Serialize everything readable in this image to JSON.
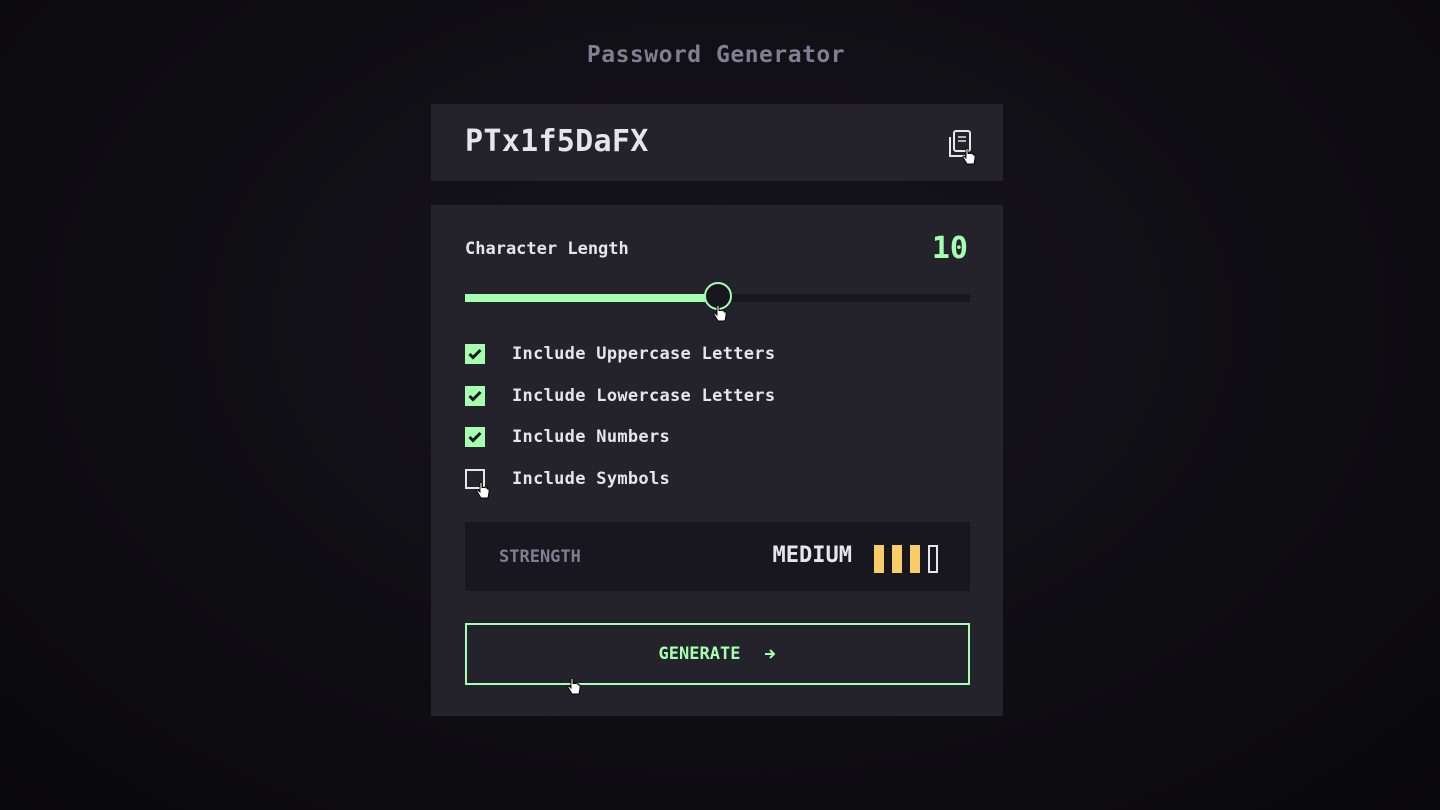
{
  "app": {
    "title": "Password Generator"
  },
  "output": {
    "password": "PTx1f5DaFX",
    "copy_icon": "copy-icon"
  },
  "length": {
    "label": "Character Length",
    "value": "10",
    "slider_fraction": 0.5
  },
  "options": [
    {
      "label": "Include Uppercase Letters",
      "checked": true
    },
    {
      "label": "Include Lowercase Letters",
      "checked": true
    },
    {
      "label": "Include Numbers",
      "checked": true
    },
    {
      "label": "Include Symbols",
      "checked": false
    }
  ],
  "strength": {
    "label": "STRENGTH",
    "value": "MEDIUM",
    "level": 3,
    "max_level": 4
  },
  "generate": {
    "label": "GENERATE",
    "icon": "arrow-right-icon"
  },
  "colors": {
    "accent": "#a4ffaf",
    "strength_medium": "#f8cd65",
    "panel": "#24232c",
    "dark": "#18171f",
    "muted": "#817d92",
    "text": "#e6e5ea"
  }
}
